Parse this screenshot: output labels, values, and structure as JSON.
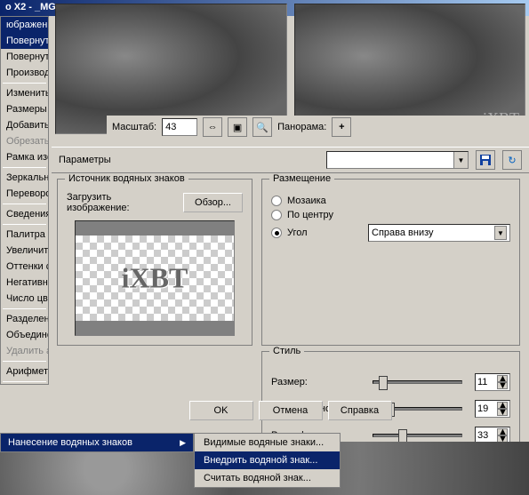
{
  "title": "o X2 - _MG",
  "menu_header": "юбражение",
  "menu": {
    "items": [
      "Повернуть",
      "Повернуть",
      "Производн",
      "",
      "Изменить р",
      "Размеры хо",
      "Добавить п",
      "Обрезать п",
      "Рамка изоб",
      "",
      "Зеркальное",
      "Переворот",
      "",
      "Сведения о",
      "",
      "Палитра",
      "Увеличить",
      "Оттенки се",
      "Негативное",
      "Число цвет",
      "",
      "Разделение",
      "Объединен",
      "Удалить ал",
      "",
      "Арифметич"
    ],
    "hover_index": 0,
    "watermark": "Нанесение водяных знаков"
  },
  "submenu": {
    "visible": "Видимые водяные знаки...",
    "embed": "Внедрить водяной знак...",
    "read": "Считать водяной знак..."
  },
  "preview_watermark": "iXBT",
  "scalebar": {
    "label": "Масштаб:",
    "value": "43",
    "panorama": "Панорама:",
    "plus": "+"
  },
  "params": {
    "label": "Параметры"
  },
  "source": {
    "legend": "Источник водяных знаков",
    "load_label": "Загрузить изображение:",
    "browse": "Обзор...",
    "thumb_text": "iXBT"
  },
  "placement": {
    "legend": "Размещение",
    "mosaic": "Мозаика",
    "center": "По центру",
    "corner": "Угол",
    "dd_value": "Справа внизу"
  },
  "style": {
    "legend": "Стиль",
    "size_l": "Размер:",
    "size_v": "11",
    "opac_l": "Непрозрачность:",
    "opac_v": "19",
    "relief_l": "Рельеф:",
    "relief_v": "33"
  },
  "buttons": {
    "ok": "OK",
    "cancel": "Отмена",
    "help": "Справка"
  }
}
